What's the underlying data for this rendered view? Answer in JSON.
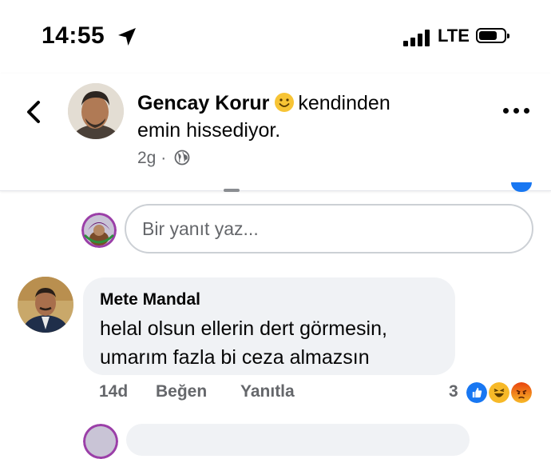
{
  "status_bar": {
    "time": "14:55",
    "network": "LTE",
    "battery_level": 0.7,
    "icons": [
      "location-arrow-icon",
      "signal-icon",
      "battery-icon"
    ]
  },
  "header": {
    "poster_name": "Gencay Korur",
    "feeling_line1": "kendinden",
    "feeling_line2": "emin hissediyor.",
    "time_ago": "2g",
    "separator": "·",
    "icons": [
      "back-chevron-icon",
      "smile-emoji-icon",
      "globe-icon",
      "more-icon"
    ]
  },
  "reply_box": {
    "placeholder": "Bir yanıt yaz..."
  },
  "comment": {
    "author": "Mete Mandal",
    "line1": "helal olsun ellerin dert görmesin,",
    "line2": "umarım fazla bi ceza almazsın",
    "time": "14d",
    "like_label": "Beğen",
    "reply_label": "Yanıtla",
    "reaction_count": "3",
    "reactions": [
      "like-reaction-icon",
      "haha-reaction-icon",
      "angry-reaction-icon"
    ],
    "colors": {
      "like": "#1877f2",
      "haha": "#f7b928",
      "angry": "#e9710f"
    }
  }
}
